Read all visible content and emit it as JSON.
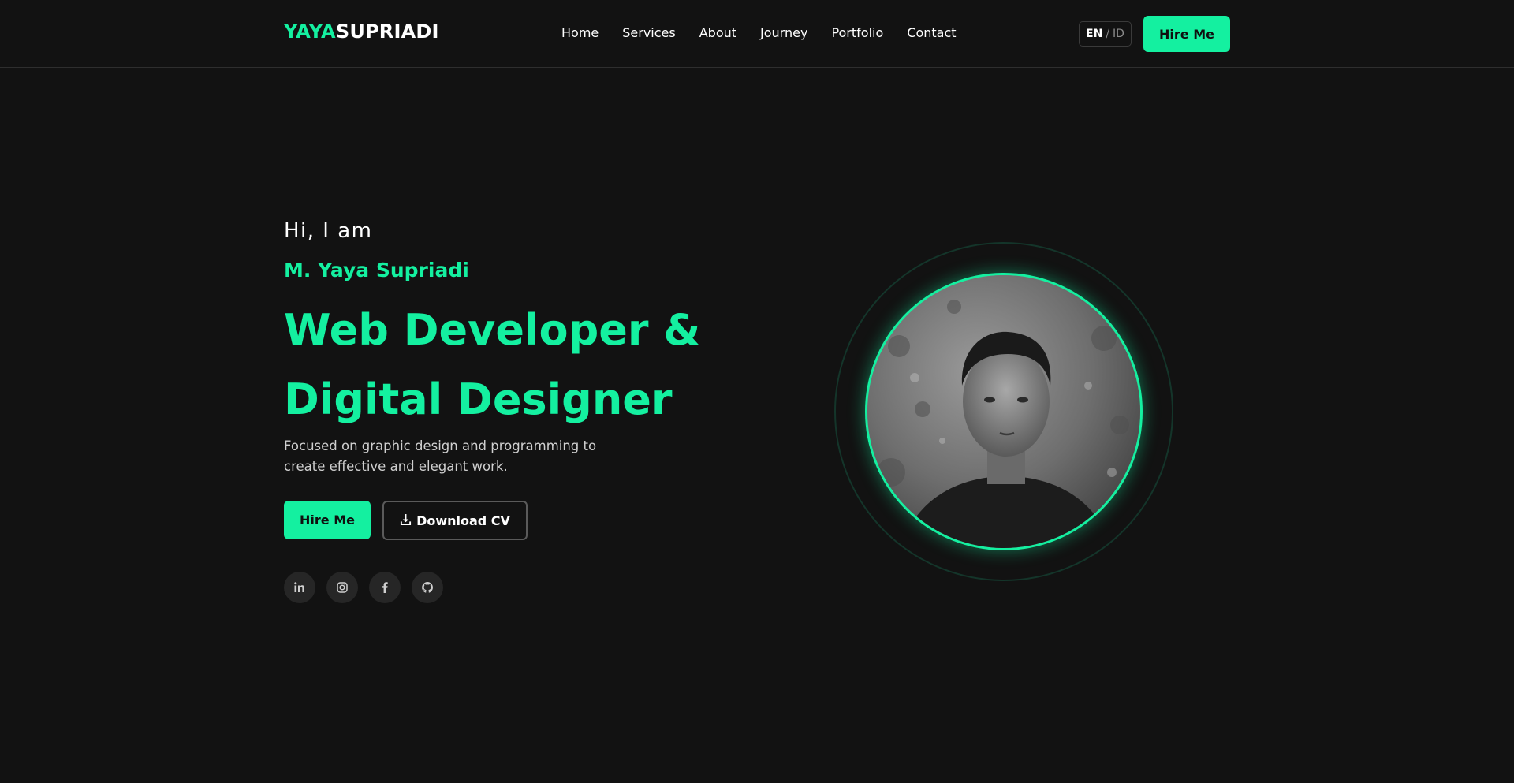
{
  "header": {
    "logo_accent": "YAYA",
    "logo_rest": "SUPRIADI",
    "nav": [
      "Home",
      "Services",
      "About",
      "Journey",
      "Portfolio",
      "Contact"
    ],
    "lang_active": "EN",
    "lang_separator": "/",
    "lang_inactive": "ID",
    "hire_label": "Hire Me"
  },
  "hero": {
    "greeting": "Hi, I am",
    "name": "M. Yaya Supriadi",
    "title_line1": "Web Developer &",
    "title_line2": "Digital Designer",
    "description": "Focused on graphic design and programming to create effective and elegant work.",
    "hire_label": "Hire Me",
    "download_label": "Download CV",
    "social": [
      "linkedin-icon",
      "instagram-icon",
      "facebook-icon",
      "github-icon"
    ]
  },
  "colors": {
    "accent": "#14f0a0",
    "background": "#121212"
  }
}
